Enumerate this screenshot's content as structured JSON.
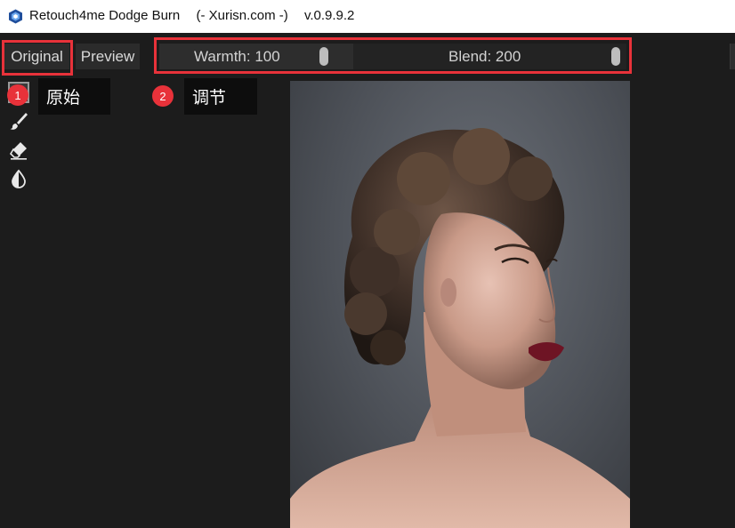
{
  "window": {
    "title": "Retouch4me Dodge Burn",
    "subtitle": "(- Xurisn.com -)",
    "version": "v.0.9.9.2",
    "icon": "app-logo-icon"
  },
  "toolbar": {
    "original_label": "Original",
    "preview_label": "Preview"
  },
  "sliders": {
    "warmth_label": "Warmth: 100",
    "warmth_value": 100,
    "blend_label": "Blend: 200",
    "blend_value": 200
  },
  "tools": [
    {
      "name": "select-tool",
      "icon": "select-square-icon"
    },
    {
      "name": "brush-tool",
      "icon": "brush-icon"
    },
    {
      "name": "eraser-tool",
      "icon": "eraser-icon"
    },
    {
      "name": "opacity-tool",
      "icon": "half-drop-icon"
    }
  ],
  "annotations": [
    {
      "number": "1",
      "text": "原始"
    },
    {
      "number": "2",
      "text": "调节"
    }
  ],
  "colors": {
    "annotation_red": "#e8323a",
    "background": "#1c1c1c",
    "button_bg": "#2b2b2b"
  }
}
